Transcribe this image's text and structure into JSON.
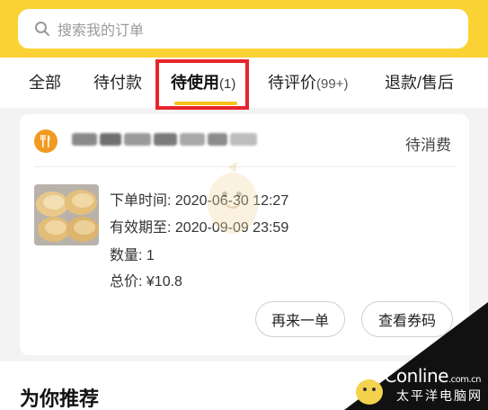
{
  "search": {
    "placeholder": "搜索我的订单"
  },
  "tabs": [
    {
      "label": "全部",
      "count": ""
    },
    {
      "label": "待付款",
      "count": ""
    },
    {
      "label": "待使用",
      "count": "(1)"
    },
    {
      "label": "待评价",
      "count": "(99+)"
    },
    {
      "label": "退款/售后",
      "count": ""
    }
  ],
  "order": {
    "status": "待消费",
    "order_time_label": "下单时间: 2020-06-30 12:27",
    "valid_until_label": "有效期至: 2020-09-09 23:59",
    "quantity_label": "数量: 1",
    "total_label": "总价: ¥10.8",
    "buttons": {
      "reorder": "再来一单",
      "view_voucher": "查看券码"
    }
  },
  "recommend": {
    "title": "为你推荐"
  },
  "watermark": {
    "brand": "PConline",
    "domain": ".com.cn",
    "sub": "太平洋电脑网"
  },
  "colors": {
    "accent": "#fbd233",
    "tab_underline": "#f7c21c",
    "highlight": "#e8252b",
    "store_icon": "#f29a1f"
  }
}
